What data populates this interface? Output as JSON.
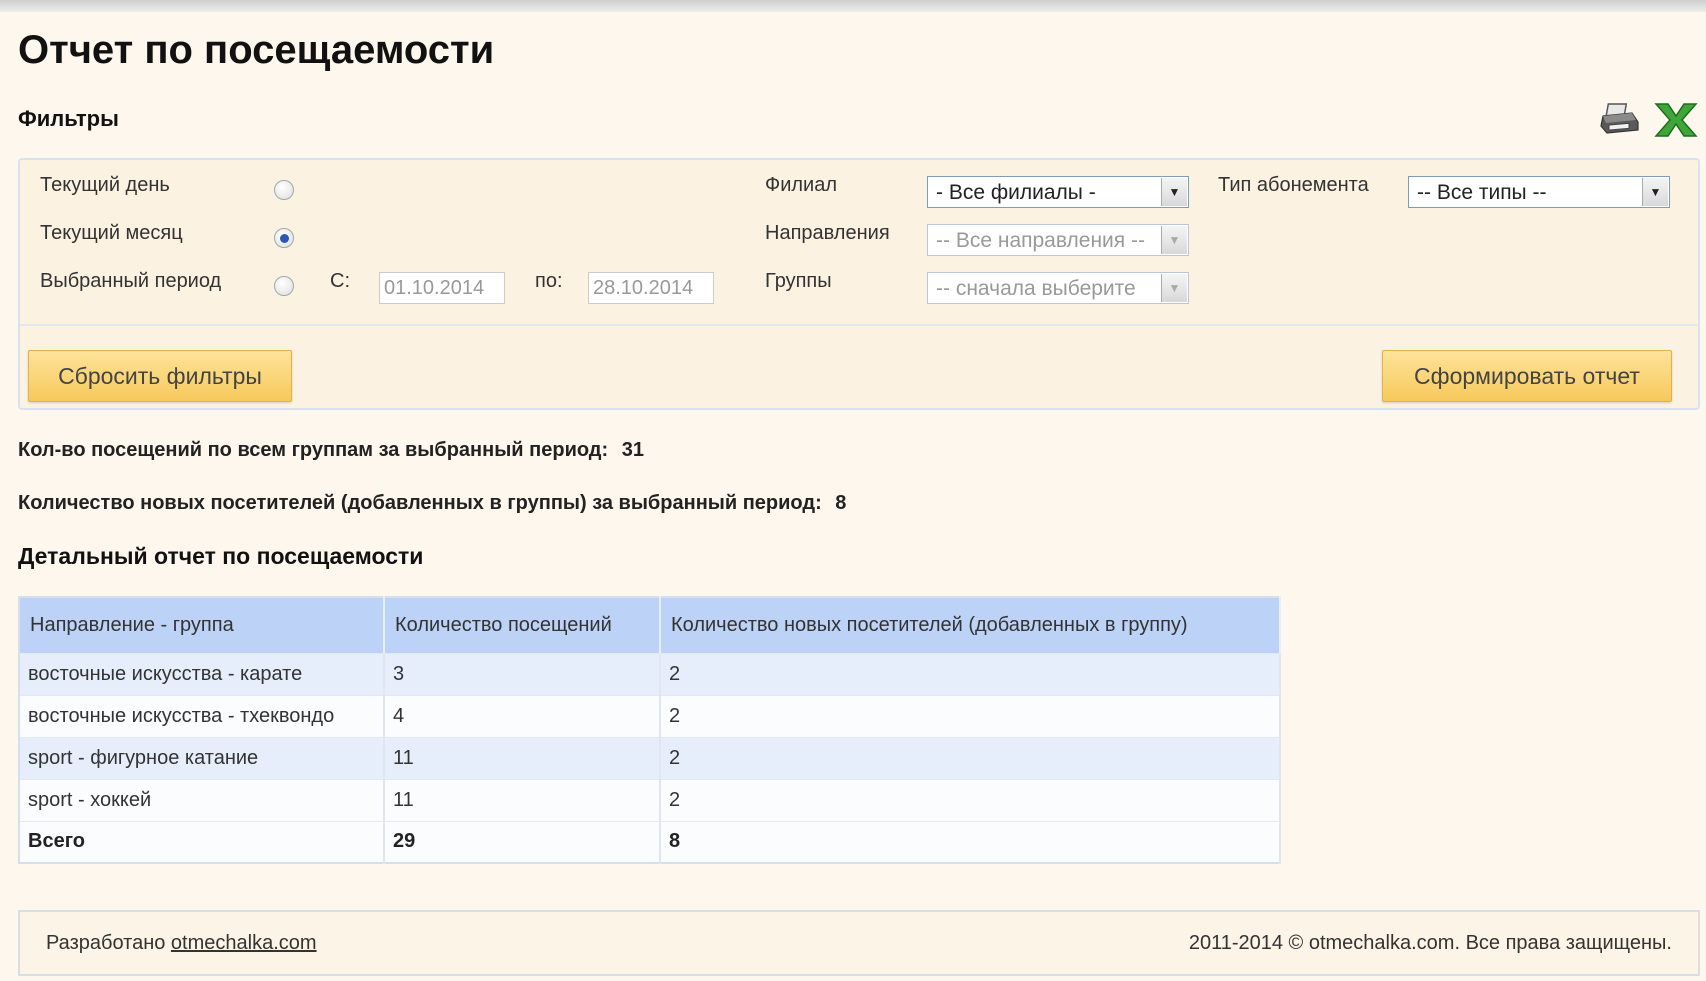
{
  "page": {
    "title": "Отчет по посещаемости"
  },
  "filters": {
    "title": "Фильтры",
    "period": {
      "current_day_label": "Текущий день",
      "current_month_label": "Текущий месяц",
      "selected_period_label": "Выбранный период",
      "selected": "current_month",
      "from_label": "С:",
      "from_value": "01.10.2014",
      "to_label": "по:",
      "to_value": "28.10.2014"
    },
    "branch": {
      "label": "Филиал",
      "value": "- Все филиалы -"
    },
    "directions": {
      "label": "Направления",
      "value": "-- Все направления --"
    },
    "groups": {
      "label": "Группы",
      "value": "-- сначала выберите"
    },
    "subscription_type": {
      "label": "Тип абонемента",
      "value": "-- Все типы --"
    },
    "reset_button": "Сбросить фильтры",
    "generate_button": "Сформировать отчет"
  },
  "toolbar": {
    "print_icon": "printer-icon",
    "excel_icon": "excel-icon"
  },
  "stats": {
    "visits_label": "Кол-во посещений по всем группам за выбранный период:",
    "visits_value": "31",
    "new_label": "Количество новых посетителей (добавленных в группы) за выбранный период:",
    "new_value": "8"
  },
  "report": {
    "title": "Детальный отчет по посещаемости",
    "columns": [
      "Направление - группа",
      "Количество посещений",
      "Количество новых посетителей (добавленных в группу)"
    ],
    "rows": [
      [
        "восточные искусства - карате",
        "3",
        "2"
      ],
      [
        "восточные искусства - тхеквондо",
        "4",
        "2"
      ],
      [
        "sport - фигурное катание",
        "11",
        "2"
      ],
      [
        "sport - хоккей",
        "11",
        "2"
      ]
    ],
    "total": [
      "Всего",
      "29",
      "8"
    ]
  },
  "footer": {
    "developed_label": "Разработано",
    "developed_link": "otmechalka.com",
    "copyright": "2011-2014 © otmechalka.com. Все права защищены."
  },
  "colors": {
    "background": "#fdf7ee",
    "table_header": "#bcd2f7",
    "button": "#f6c95c",
    "radio_checked": "#2b58b0"
  }
}
